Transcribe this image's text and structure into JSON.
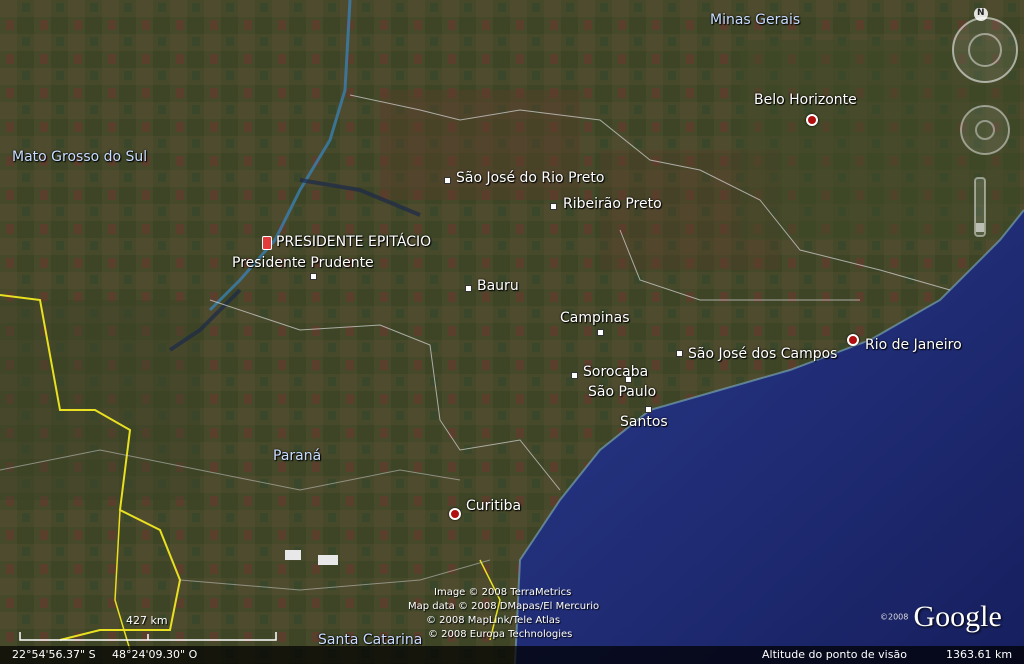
{
  "regions": {
    "minas_gerais": "Minas Gerais",
    "mato_grosso_do_sul": "Mato Grosso do Sul",
    "parana": "Paraná",
    "santa_catarina": "Santa Catarina"
  },
  "cities": {
    "belo_horizonte": "Belo Horizonte",
    "sao_jose_rio_preto": "São José do Rio Preto",
    "ribeirao_preto": "Ribeirão Preto",
    "presidente_epitacio": "PRESIDENTE EPITÁCIO",
    "presidente_prudente": "Presidente Prudente",
    "bauru": "Bauru",
    "campinas": "Campinas",
    "sao_jose_campos": "São José dos Campos",
    "rio_de_janeiro": "Rio de Janeiro",
    "sorocaba": "Sorocaba",
    "sao_paulo": "São Paulo",
    "santos": "Santos",
    "curitiba": "Curitiba"
  },
  "attribution": [
    "Image © 2008 TerraMetrics",
    "Map data © 2008 DMapas/El Mercurio",
    "© 2008 MapLink/Tele Atlas",
    "© 2008 Europa Technologies"
  ],
  "logo": {
    "copyright": "©2008",
    "brand": "Google"
  },
  "compass": {
    "north_label": "N"
  },
  "scale": {
    "label": "427 km"
  },
  "status": {
    "latitude": "22°54'56.37\" S",
    "longitude": "48°24'09.30\" O",
    "altitude_label": "Altitude do ponto de visão",
    "altitude_value": "1363.61 km"
  },
  "colors": {
    "ocean": "#1f2f78",
    "land": "#4a4a2a",
    "border": "#e8e020",
    "roads": "#cfcfcf"
  }
}
